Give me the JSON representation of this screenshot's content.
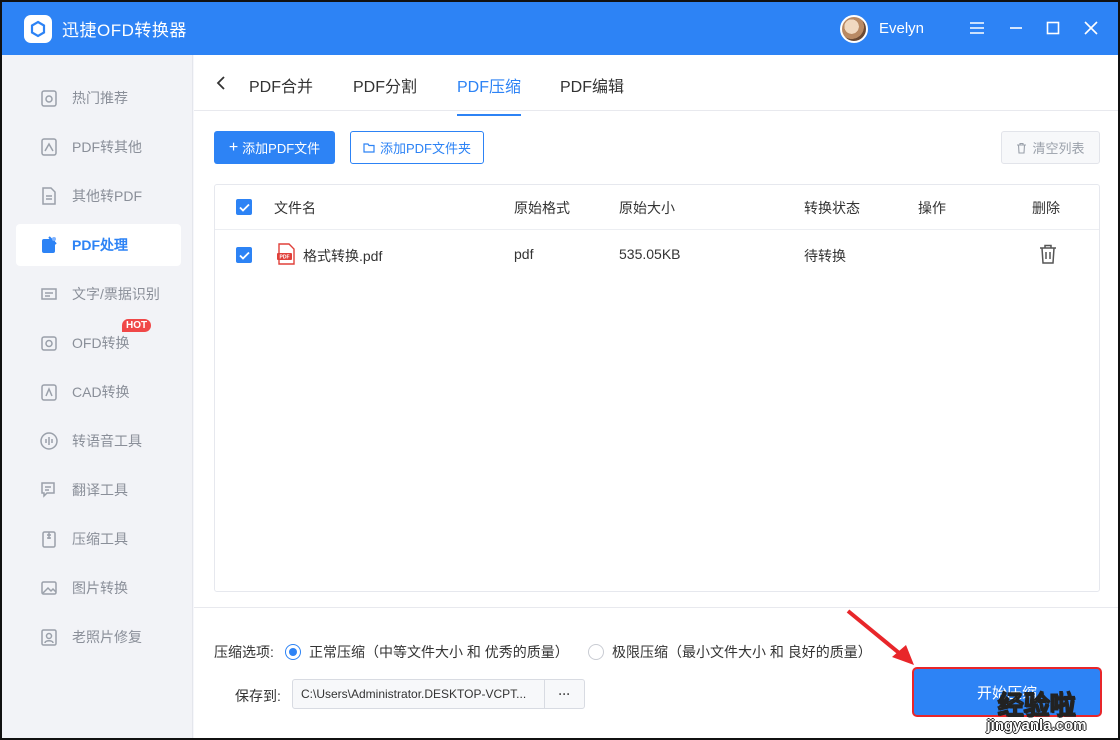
{
  "app": {
    "title": "迅捷OFD转换器",
    "user": "Evelyn",
    "accent": "#2d83f5"
  },
  "sidebar": {
    "items": [
      {
        "label": "热门推荐",
        "icon": "hot-recommend-icon"
      },
      {
        "label": "PDF转其他",
        "icon": "pdf-convert-icon"
      },
      {
        "label": "其他转PDF",
        "icon": "to-pdf-icon"
      },
      {
        "label": "PDF处理",
        "icon": "pdf-process-icon",
        "active": true
      },
      {
        "label": "文字/票据识别",
        "icon": "ocr-icon"
      },
      {
        "label": "OFD转换",
        "icon": "ofd-icon",
        "badge": "HOT"
      },
      {
        "label": "CAD转换",
        "icon": "cad-icon"
      },
      {
        "label": "转语音工具",
        "icon": "voice-icon"
      },
      {
        "label": "翻译工具",
        "icon": "translate-icon"
      },
      {
        "label": "压缩工具",
        "icon": "compress-icon"
      },
      {
        "label": "图片转换",
        "icon": "image-icon"
      },
      {
        "label": "老照片修复",
        "icon": "photo-restore-icon"
      }
    ]
  },
  "tabs": [
    "PDF合并",
    "PDF分割",
    "PDF压缩",
    "PDF编辑"
  ],
  "toolbar": {
    "add_file": "添加PDF文件",
    "add_folder": "添加PDF文件夹",
    "clear": "清空列表"
  },
  "table": {
    "headers": {
      "name": "文件名",
      "format": "原始格式",
      "size": "原始大小",
      "status": "转换状态",
      "action": "操作",
      "delete": "删除"
    },
    "rows": [
      {
        "name": "格式转换.pdf",
        "format": "pdf",
        "size": "535.05KB",
        "status": "待转换"
      }
    ]
  },
  "options": {
    "label": "压缩选项:",
    "normal": "正常压缩（中等文件大小 和 优秀的质量）",
    "extreme": "极限压缩（最小文件大小 和 良好的质量）",
    "save_label": "保存到:",
    "save_path": "C:\\Users\\Administrator.DESKTOP-VCPT...",
    "browse": "···"
  },
  "start_button": "开始压缩",
  "watermark": {
    "line1": "经验啦",
    "line2": "jingyanla.com"
  }
}
